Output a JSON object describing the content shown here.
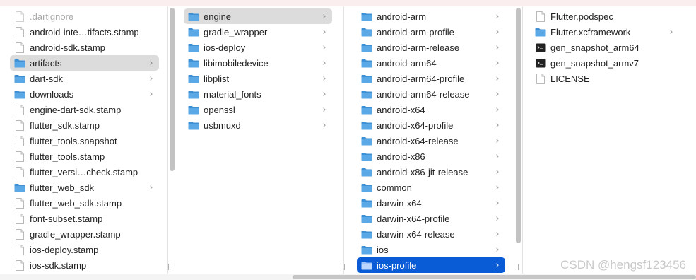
{
  "columns": [
    {
      "items": [
        {
          "label": ".dartignore",
          "icon": "document-icon",
          "dim": true
        },
        {
          "label": "android-inte…tifacts.stamp",
          "icon": "document-icon"
        },
        {
          "label": "android-sdk.stamp",
          "icon": "document-icon"
        },
        {
          "label": "artifacts",
          "icon": "folder-icon",
          "chevron": true,
          "selected": "gray"
        },
        {
          "label": "dart-sdk",
          "icon": "folder-icon",
          "chevron": true
        },
        {
          "label": "downloads",
          "icon": "folder-icon",
          "chevron": true
        },
        {
          "label": "engine-dart-sdk.stamp",
          "icon": "document-icon"
        },
        {
          "label": "flutter_sdk.stamp",
          "icon": "document-icon"
        },
        {
          "label": "flutter_tools.snapshot",
          "icon": "document-icon"
        },
        {
          "label": "flutter_tools.stamp",
          "icon": "document-icon"
        },
        {
          "label": "flutter_versi…check.stamp",
          "icon": "document-icon"
        },
        {
          "label": "flutter_web_sdk",
          "icon": "folder-icon",
          "chevron": true
        },
        {
          "label": "flutter_web_sdk.stamp",
          "icon": "document-icon"
        },
        {
          "label": "font-subset.stamp",
          "icon": "document-icon"
        },
        {
          "label": "gradle_wrapper.stamp",
          "icon": "document-icon"
        },
        {
          "label": "ios-deploy.stamp",
          "icon": "document-icon"
        },
        {
          "label": "ios-sdk.stamp",
          "icon": "document-icon"
        }
      ]
    },
    {
      "items": [
        {
          "label": "engine",
          "icon": "folder-icon",
          "chevron": true,
          "selected": "gray"
        },
        {
          "label": "gradle_wrapper",
          "icon": "folder-icon",
          "chevron": true
        },
        {
          "label": "ios-deploy",
          "icon": "folder-icon",
          "chevron": true
        },
        {
          "label": "libimobiledevice",
          "icon": "folder-icon",
          "chevron": true
        },
        {
          "label": "libplist",
          "icon": "folder-icon",
          "chevron": true
        },
        {
          "label": "material_fonts",
          "icon": "folder-icon",
          "chevron": true
        },
        {
          "label": "openssl",
          "icon": "folder-icon",
          "chevron": true
        },
        {
          "label": "usbmuxd",
          "icon": "folder-icon",
          "chevron": true
        }
      ]
    },
    {
      "items": [
        {
          "label": "android-arm",
          "icon": "folder-icon",
          "chevron": true
        },
        {
          "label": "android-arm-profile",
          "icon": "folder-icon",
          "chevron": true
        },
        {
          "label": "android-arm-release",
          "icon": "folder-icon",
          "chevron": true
        },
        {
          "label": "android-arm64",
          "icon": "folder-icon",
          "chevron": true
        },
        {
          "label": "android-arm64-profile",
          "icon": "folder-icon",
          "chevron": true
        },
        {
          "label": "android-arm64-release",
          "icon": "folder-icon",
          "chevron": true
        },
        {
          "label": "android-x64",
          "icon": "folder-icon",
          "chevron": true
        },
        {
          "label": "android-x64-profile",
          "icon": "folder-icon",
          "chevron": true
        },
        {
          "label": "android-x64-release",
          "icon": "folder-icon",
          "chevron": true
        },
        {
          "label": "android-x86",
          "icon": "folder-icon",
          "chevron": true
        },
        {
          "label": "android-x86-jit-release",
          "icon": "folder-icon",
          "chevron": true
        },
        {
          "label": "common",
          "icon": "folder-icon",
          "chevron": true
        },
        {
          "label": "darwin-x64",
          "icon": "folder-icon",
          "chevron": true
        },
        {
          "label": "darwin-x64-profile",
          "icon": "folder-icon",
          "chevron": true
        },
        {
          "label": "darwin-x64-release",
          "icon": "folder-icon",
          "chevron": true
        },
        {
          "label": "ios",
          "icon": "folder-icon",
          "chevron": true
        },
        {
          "label": "ios-profile",
          "icon": "folder-icon",
          "chevron": true,
          "selected": "blue"
        }
      ]
    },
    {
      "items": [
        {
          "label": "Flutter.podspec",
          "icon": "document-icon"
        },
        {
          "label": "Flutter.xcframework",
          "icon": "folder-icon",
          "chevron": true
        },
        {
          "label": "gen_snapshot_arm64",
          "icon": "terminal-executable-icon"
        },
        {
          "label": "gen_snapshot_armv7",
          "icon": "terminal-executable-icon"
        },
        {
          "label": "LICENSE",
          "icon": "document-icon"
        }
      ]
    }
  ],
  "chevron_glyph": "›",
  "resize_glyph": "||",
  "watermark": "CSDN @hengsf123456",
  "colors": {
    "selection_blue": "#0a5bd6",
    "selection_gray": "#dcdcdc",
    "folder_blue": "#5aa9e6",
    "folder_blue_dark": "#3f8fd4",
    "title_bar_pink": "#fbeeee"
  }
}
